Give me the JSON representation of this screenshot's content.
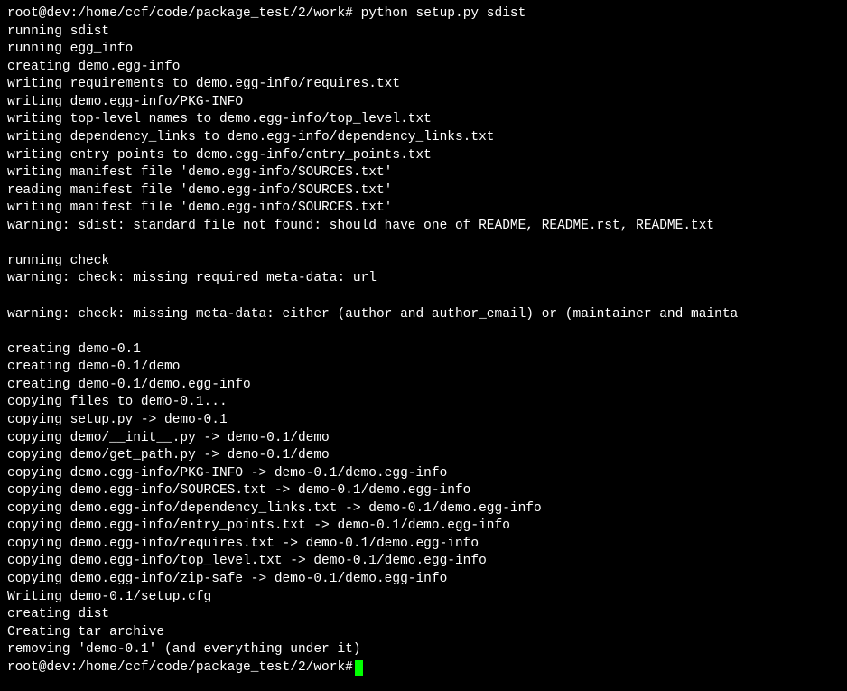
{
  "terminal": {
    "prompt1": "root@dev:/home/ccf/code/package_test/2/work# ",
    "command1": "python setup.py sdist",
    "lines": [
      "running sdist",
      "running egg_info",
      "creating demo.egg-info",
      "writing requirements to demo.egg-info/requires.txt",
      "writing demo.egg-info/PKG-INFO",
      "writing top-level names to demo.egg-info/top_level.txt",
      "writing dependency_links to demo.egg-info/dependency_links.txt",
      "writing entry points to demo.egg-info/entry_points.txt",
      "writing manifest file 'demo.egg-info/SOURCES.txt'",
      "reading manifest file 'demo.egg-info/SOURCES.txt'",
      "writing manifest file 'demo.egg-info/SOURCES.txt'",
      "warning: sdist: standard file not found: should have one of README, README.rst, README.txt",
      "",
      "running check",
      "warning: check: missing required meta-data: url",
      "",
      "warning: check: missing meta-data: either (author and author_email) or (maintainer and mainta",
      "",
      "creating demo-0.1",
      "creating demo-0.1/demo",
      "creating demo-0.1/demo.egg-info",
      "copying files to demo-0.1...",
      "copying setup.py -> demo-0.1",
      "copying demo/__init__.py -> demo-0.1/demo",
      "copying demo/get_path.py -> demo-0.1/demo",
      "copying demo.egg-info/PKG-INFO -> demo-0.1/demo.egg-info",
      "copying demo.egg-info/SOURCES.txt -> demo-0.1/demo.egg-info",
      "copying demo.egg-info/dependency_links.txt -> demo-0.1/demo.egg-info",
      "copying demo.egg-info/entry_points.txt -> demo-0.1/demo.egg-info",
      "copying demo.egg-info/requires.txt -> demo-0.1/demo.egg-info",
      "copying demo.egg-info/top_level.txt -> demo-0.1/demo.egg-info",
      "copying demo.egg-info/zip-safe -> demo-0.1/demo.egg-info",
      "Writing demo-0.1/setup.cfg",
      "creating dist",
      "Creating tar archive",
      "removing 'demo-0.1' (and everything under it)"
    ],
    "prompt2": "root@dev:/home/ccf/code/package_test/2/work# "
  }
}
